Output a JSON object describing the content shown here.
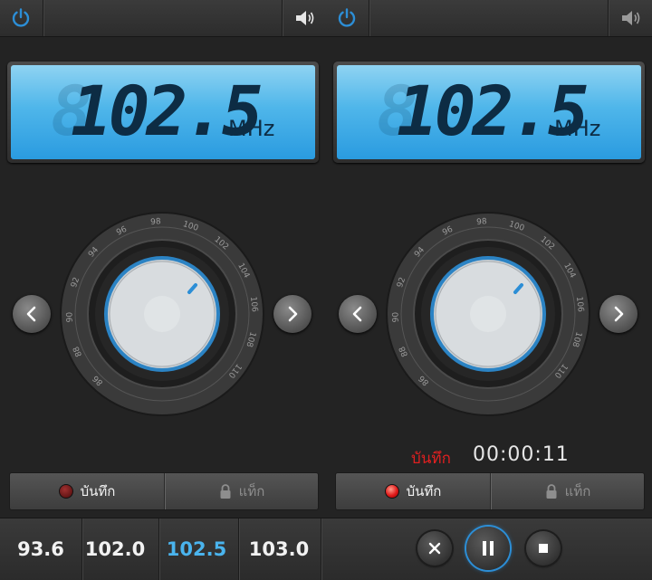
{
  "panels": [
    {
      "frequency": "102.5",
      "ghost_digits": "8",
      "unit": "MHz",
      "record_label": "บันทึก",
      "tag_label": "แท็ก",
      "recording": false
    },
    {
      "frequency": "102.5",
      "ghost_digits": "8",
      "unit": "MHz",
      "record_label": "บันทึก",
      "tag_label": "แท็ก",
      "recording": true,
      "rec_status_label": "บันทึก",
      "rec_timer": "00:00:11"
    }
  ],
  "dial_ticks": [
    "86",
    "88",
    "90",
    "92",
    "94",
    "96",
    "98",
    "100",
    "102",
    "104",
    "106",
    "108",
    "110"
  ],
  "presets": [
    {
      "label": "93.6",
      "active": false
    },
    {
      "label": "102.0",
      "active": false
    },
    {
      "label": "102.5",
      "active": true
    },
    {
      "label": "103.0",
      "active": false
    }
  ],
  "icons": {
    "power": "power-icon",
    "volume": "speaker-icon",
    "prev": "chevron-left-icon",
    "next": "chevron-right-icon",
    "lock": "lock-icon",
    "close": "close-icon",
    "pause": "pause-icon",
    "stop": "stop-icon"
  },
  "colors": {
    "accent": "#2c8ed6",
    "lcd": "#4fb6ea",
    "record_red": "#e02020",
    "active_preset": "#4ab4ee"
  }
}
